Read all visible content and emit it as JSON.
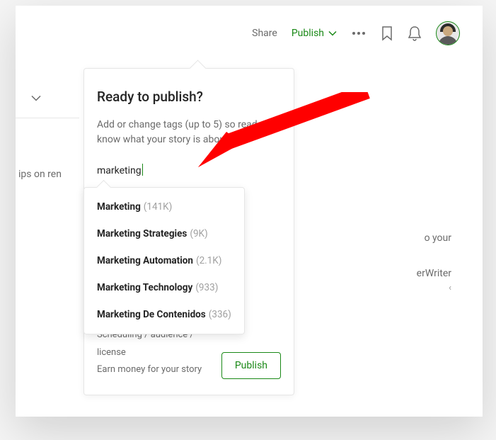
{
  "colors": {
    "accent": "#1a8917",
    "text_muted": "#6b6b6b",
    "annotation": "#ff0000"
  },
  "toprow": {
    "share": "Share",
    "publish": "Publish"
  },
  "background": {
    "title_fragment": "ips on ren",
    "line1": "o your",
    "line2": "erWriter",
    "line3": "‹"
  },
  "popover": {
    "title": "Ready to publish?",
    "desc": "Add or change tags (up to 5) so readers know what your story is about:",
    "input_value": "marketing",
    "links": {
      "scheduling": "Scheduling / audience / license",
      "earn": "Earn money for your story"
    },
    "publish_btn": "Publish"
  },
  "suggestions": [
    {
      "name": "Marketing",
      "count": "(141K)"
    },
    {
      "name": "Marketing Strategies",
      "count": "(9K)"
    },
    {
      "name": "Marketing Automation",
      "count": "(2.1K)"
    },
    {
      "name": "Marketing Technology",
      "count": "(933)"
    },
    {
      "name": "Marketing De Contenidos",
      "count": "(336)"
    }
  ]
}
